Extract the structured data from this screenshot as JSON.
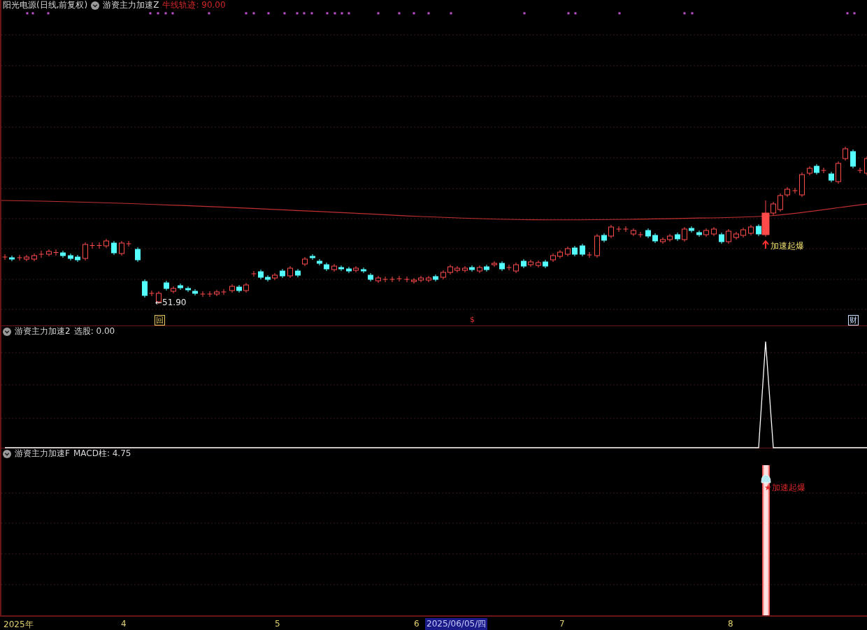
{
  "main_panel": {
    "title": "阳光电源(日线,前复权)",
    "indicator": "游资主力加速Z",
    "reading": "牛线轨迹: 90.00",
    "low_label": "←51.90",
    "signal_label": "加速起爆",
    "markers": [
      {
        "text": "回",
        "kind": "boxed",
        "color": "#e8c860"
      },
      {
        "text": "$",
        "kind": "plain",
        "color": "#e03030"
      },
      {
        "text": "财",
        "kind": "boxed",
        "color": "#c8e0ff"
      }
    ]
  },
  "sub_panel_1": {
    "indicator": "游资主力加速2",
    "reading": "选股: 0.00"
  },
  "sub_panel_2": {
    "indicator": "游资主力加速F",
    "reading": "MACD柱: 4.75",
    "signal_label": "★加速起爆"
  },
  "time_axis": [
    {
      "label": "2025年",
      "selected": false
    },
    {
      "label": "4",
      "selected": false
    },
    {
      "label": "5",
      "selected": false
    },
    {
      "label": "6",
      "selected": false
    },
    {
      "label": "2025/06/05/四",
      "selected": true
    },
    {
      "label": "7",
      "selected": false
    },
    {
      "label": "8",
      "selected": false
    }
  ]
}
